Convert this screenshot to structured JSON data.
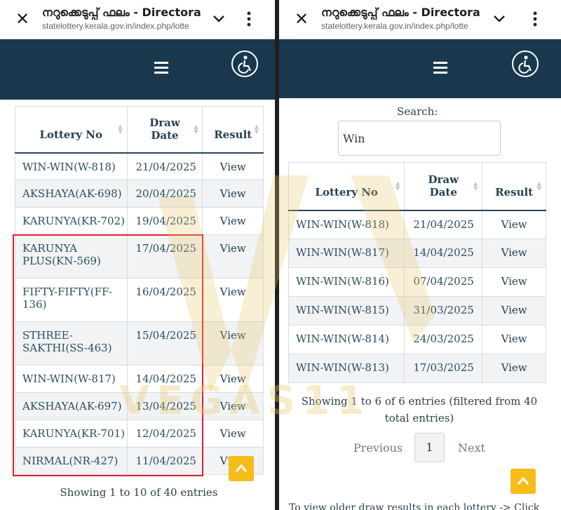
{
  "browser": {
    "page_title": "നറുക്കെടുപ്പ് ഫലം - Directora",
    "url": "statelottery.kerala.gov.in/index.php/lotte"
  },
  "left": {
    "table": {
      "headers": {
        "lottery": "Lottery No",
        "draw_date_1": "Draw",
        "draw_date_2": "Date",
        "result": "Result"
      },
      "rows": [
        {
          "lottery": "WIN-WIN(W-818)",
          "date": "21/04/2025",
          "result": "View"
        },
        {
          "lottery": "AKSHAYA(AK-698)",
          "date": "20/04/2025",
          "result": "View"
        },
        {
          "lottery": "KARUNYA(KR-702)",
          "date": "19/04/2025",
          "result": "View"
        },
        {
          "lottery": "KARUNYA PLUS(KN-569)",
          "date": "17/04/2025",
          "result": "View"
        },
        {
          "lottery": "FIFTY-FIFTY(FF-136)",
          "date": "16/04/2025",
          "result": "View"
        },
        {
          "lottery": "STHREE-SAKTHI(SS-463)",
          "date": "15/04/2025",
          "result": "View"
        },
        {
          "lottery": "WIN-WIN(W-817)",
          "date": "14/04/2025",
          "result": "View"
        },
        {
          "lottery": "AKSHAYA(AK-697)",
          "date": "13/04/2025",
          "result": "View"
        },
        {
          "lottery": "KARUNYA(KR-701)",
          "date": "12/04/2025",
          "result": "View"
        },
        {
          "lottery": "NIRMAL(NR-427)",
          "date": "11/04/2025",
          "result": "View"
        }
      ]
    },
    "info": "Showing 1 to 10 of 40 entries"
  },
  "right": {
    "search": {
      "label": "Search:",
      "value": "Win"
    },
    "table": {
      "headers": {
        "lottery": "Lottery No",
        "draw_date_1": "Draw",
        "draw_date_2": "Date",
        "result": "Result"
      },
      "rows": [
        {
          "lottery": "WIN-WIN(W-818)",
          "date": "21/04/2025",
          "result": "View"
        },
        {
          "lottery": "WIN-WIN(W-817)",
          "date": "14/04/2025",
          "result": "View"
        },
        {
          "lottery": "WIN-WIN(W-816)",
          "date": "07/04/2025",
          "result": "View"
        },
        {
          "lottery": "WIN-WIN(W-815)",
          "date": "31/03/2025",
          "result": "View"
        },
        {
          "lottery": "WIN-WIN(W-814)",
          "date": "24/03/2025",
          "result": "View"
        },
        {
          "lottery": "WIN-WIN(W-813)",
          "date": "17/03/2025",
          "result": "View"
        }
      ]
    },
    "info_line1": "Showing 1 to 6 of 6 entries (filtered from 40",
    "info_line2": "total entries)",
    "pagination": {
      "previous": "Previous",
      "current": "1",
      "next": "Next"
    },
    "footnote": "To view older draw results in each lottery -> Click"
  },
  "watermark": {
    "text": "VEGAS11"
  },
  "colors": {
    "header_bg": "#19384d",
    "highlight": "#e0202c",
    "scroll_top": "#f6bd1a",
    "watermark": "#e9c76a"
  }
}
